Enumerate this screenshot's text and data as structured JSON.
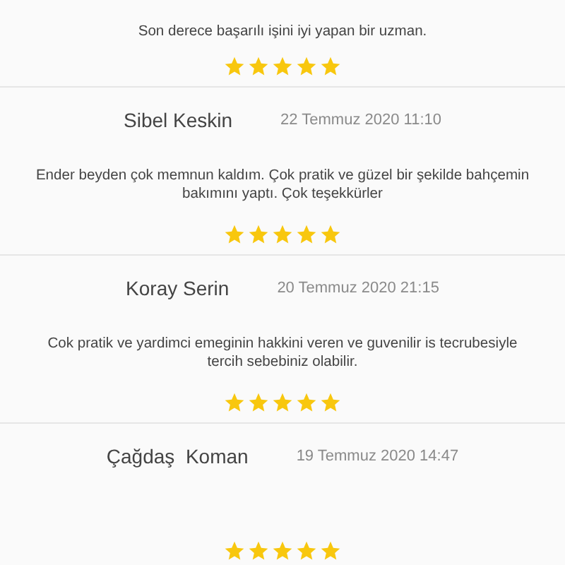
{
  "reviews": [
    {
      "comment": "Son derece başarılı işini iyi yapan bir uzman.",
      "stars": 5
    },
    {
      "name": "Sibel Keskin",
      "date": "22 Temmuz 2020 11:10",
      "comment": "Ender beyden çok memnun kaldım. Çok pratik ve güzel bir şekilde bahçemin bakımını yaptı. Çok teşekkürler",
      "stars": 5
    },
    {
      "name": "Koray Serin",
      "date": "20 Temmuz 2020 21:15",
      "comment": "Cok pratik ve yardimci emeginin hakkini veren ve guvenilir is tecrubesiyle tercih sebebiniz olabilir.",
      "stars": 5
    },
    {
      "name": "Çağdaş  Koman",
      "date": "19 Temmuz 2020 14:47",
      "stars": 5
    }
  ]
}
